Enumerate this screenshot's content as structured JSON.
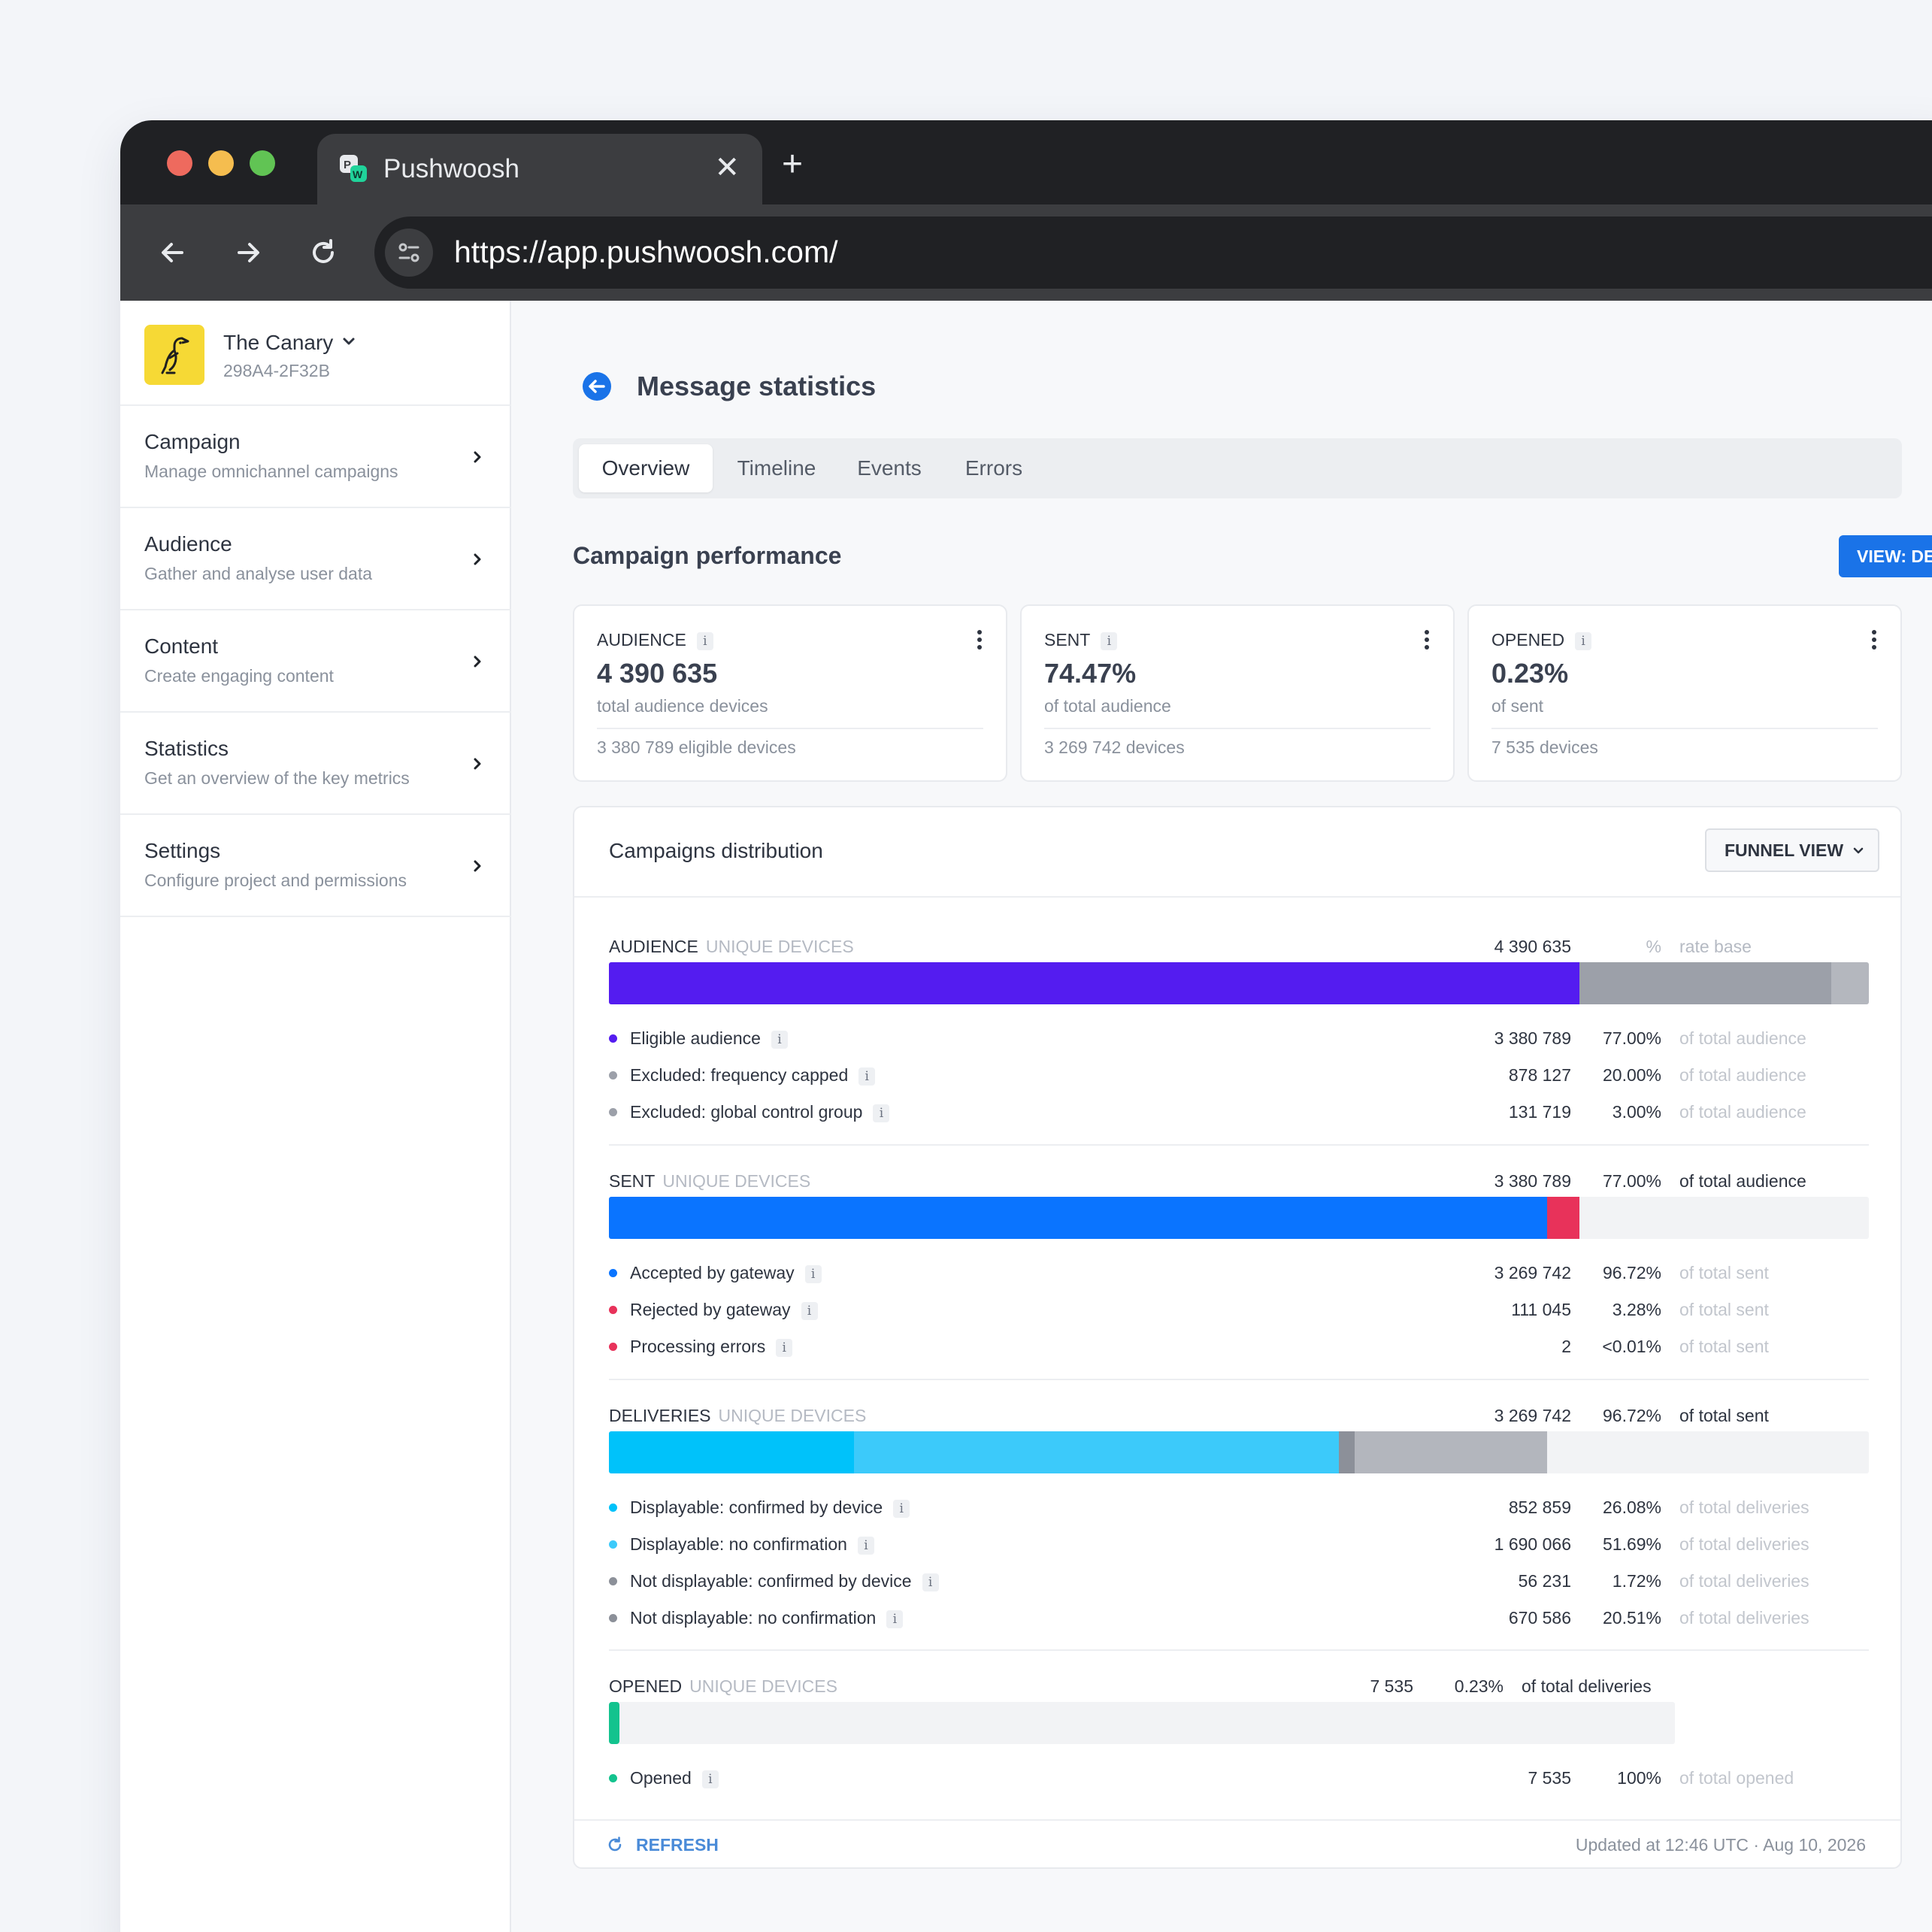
{
  "browser": {
    "tab_title": "Pushwoosh",
    "tab_close": "✕",
    "new_tab": "+",
    "url": "https://app.pushwoosh.com/"
  },
  "sidebar": {
    "project_name": "The Canary",
    "project_code": "298A4-2F32B",
    "items": [
      {
        "title": "Campaign",
        "subtitle": "Manage omnichannel campaigns"
      },
      {
        "title": "Audience",
        "subtitle": "Gather and analyse user data"
      },
      {
        "title": "Content",
        "subtitle": "Create engaging content"
      },
      {
        "title": "Statistics",
        "subtitle": "Get an overview of the key metrics"
      },
      {
        "title": "Settings",
        "subtitle": "Configure project and permissions"
      }
    ]
  },
  "page": {
    "title": "Message statistics",
    "tabs": [
      "Overview",
      "Timeline",
      "Events",
      "Errors"
    ],
    "active_tab": "Overview",
    "section_title": "Campaign performance",
    "view_button": "VIEW: DEVICES"
  },
  "metrics": [
    {
      "label": "AUDIENCE",
      "value": "4 390 635",
      "sub": "total audience devices",
      "foot": "3 380 789  eligible devices"
    },
    {
      "label": "SENT",
      "value": "74.47%",
      "sub": "of total audience",
      "foot": "3 269 742  devices"
    },
    {
      "label": "OPENED",
      "value": "0.23%",
      "sub": "of sent",
      "foot": "7 535  devices"
    }
  ],
  "distribution": {
    "title": "Campaigns distribution",
    "funnel_button": "FUNNEL VIEW",
    "unit_label": "UNIQUE DEVICES",
    "audience": {
      "label": "AUDIENCE",
      "total": "4 390 635",
      "pct": "%",
      "of": "rate base",
      "rows": [
        {
          "label": "Eligible audience",
          "value": "3 380 789",
          "pct": "77.00%",
          "of": "of total audience"
        },
        {
          "label": "Excluded: frequency capped",
          "value": "878 127",
          "pct": "20.00%",
          "of": "of total audience"
        },
        {
          "label": "Excluded: global control group",
          "value": "131 719",
          "pct": "3.00%",
          "of": "of total audience"
        }
      ]
    },
    "sent": {
      "label": "SENT",
      "total": "3 380 789",
      "pct": "77.00%",
      "of": "of total audience",
      "rows": [
        {
          "label": "Accepted by gateway",
          "value": "3 269 742",
          "pct": "96.72%",
          "of": "of total sent"
        },
        {
          "label": "Rejected by gateway",
          "value": "111 045",
          "pct": "3.28%",
          "of": "of total sent"
        },
        {
          "label": "Processing errors",
          "value": "2",
          "pct": "<0.01%",
          "of": "of total sent"
        }
      ]
    },
    "deliveries": {
      "label": "DELIVERIES",
      "total": "3 269 742",
      "pct": "96.72%",
      "of": "of total sent",
      "rows": [
        {
          "label": "Displayable: confirmed by device",
          "value": "852 859",
          "pct": "26.08%",
          "of": "of total deliveries"
        },
        {
          "label": "Displayable: no confirmation",
          "value": "1 690 066",
          "pct": "51.69%",
          "of": "of total deliveries"
        },
        {
          "label": "Not displayable: confirmed by device",
          "value": "56 231",
          "pct": "1.72%",
          "of": "of total deliveries"
        },
        {
          "label": "Not displayable: no confirmation",
          "value": "670 586",
          "pct": "20.51%",
          "of": "of total deliveries"
        }
      ]
    },
    "opened": {
      "label": "OPENED",
      "total": "7 535",
      "pct": "0.23%",
      "of": "of total deliveries",
      "rows": [
        {
          "label": "Opened",
          "value": "7 535",
          "pct": "100%",
          "of": "of total opened"
        }
      ]
    },
    "bar_fractions": {
      "audience": [
        0.77,
        0.2,
        0.03
      ],
      "sent_of_audience": 0.77,
      "sent_split": [
        0.9672,
        0.0328
      ],
      "deliveries_of_audience": 0.7447,
      "deliveries_split": [
        0.2608,
        0.5169,
        0.0172,
        0.2051
      ],
      "opened_level": 0.0023
    },
    "refresh_label": "REFRESH",
    "updated": "Updated at 12:46 UTC · Aug 10, 2026"
  },
  "colors": {
    "eligible": "#541cf0",
    "excluded": "#9ca0a9",
    "excluded_light": "#b4b7be",
    "accepted": "#0a74ff",
    "rejected": "#e8325a",
    "displayable_confirmed": "#00c2fa",
    "displayable_noconf": "#3ccafa",
    "notdisp_confirmed": "#8c9099",
    "notdisp_noconf": "#b3b6bd",
    "opened": "#13c38e",
    "primary_button": "#1a73e8"
  }
}
